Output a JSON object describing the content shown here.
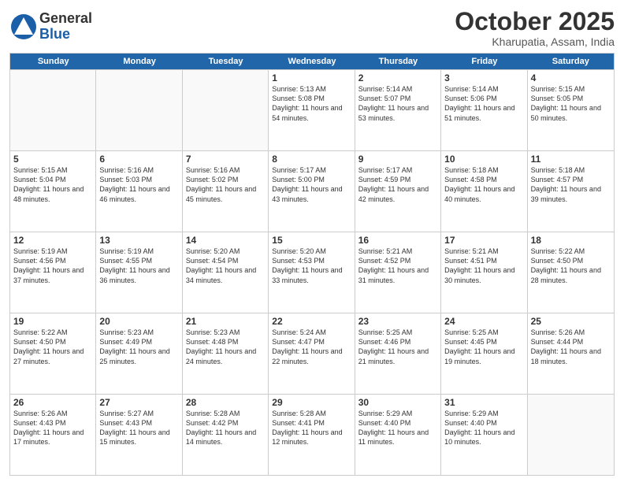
{
  "header": {
    "logo_general": "General",
    "logo_blue": "Blue",
    "month_title": "October 2025",
    "location": "Kharupatia, Assam, India"
  },
  "days_of_week": [
    "Sunday",
    "Monday",
    "Tuesday",
    "Wednesday",
    "Thursday",
    "Friday",
    "Saturday"
  ],
  "weeks": [
    [
      {
        "day": "",
        "empty": true
      },
      {
        "day": "",
        "empty": true
      },
      {
        "day": "",
        "empty": true
      },
      {
        "day": "1",
        "sunrise": "5:13 AM",
        "sunset": "5:08 PM",
        "daylight": "11 hours and 54 minutes."
      },
      {
        "day": "2",
        "sunrise": "5:14 AM",
        "sunset": "5:07 PM",
        "daylight": "11 hours and 53 minutes."
      },
      {
        "day": "3",
        "sunrise": "5:14 AM",
        "sunset": "5:06 PM",
        "daylight": "11 hours and 51 minutes."
      },
      {
        "day": "4",
        "sunrise": "5:15 AM",
        "sunset": "5:05 PM",
        "daylight": "11 hours and 50 minutes."
      }
    ],
    [
      {
        "day": "5",
        "sunrise": "5:15 AM",
        "sunset": "5:04 PM",
        "daylight": "11 hours and 48 minutes."
      },
      {
        "day": "6",
        "sunrise": "5:16 AM",
        "sunset": "5:03 PM",
        "daylight": "11 hours and 46 minutes."
      },
      {
        "day": "7",
        "sunrise": "5:16 AM",
        "sunset": "5:02 PM",
        "daylight": "11 hours and 45 minutes."
      },
      {
        "day": "8",
        "sunrise": "5:17 AM",
        "sunset": "5:00 PM",
        "daylight": "11 hours and 43 minutes."
      },
      {
        "day": "9",
        "sunrise": "5:17 AM",
        "sunset": "4:59 PM",
        "daylight": "11 hours and 42 minutes."
      },
      {
        "day": "10",
        "sunrise": "5:18 AM",
        "sunset": "4:58 PM",
        "daylight": "11 hours and 40 minutes."
      },
      {
        "day": "11",
        "sunrise": "5:18 AM",
        "sunset": "4:57 PM",
        "daylight": "11 hours and 39 minutes."
      }
    ],
    [
      {
        "day": "12",
        "sunrise": "5:19 AM",
        "sunset": "4:56 PM",
        "daylight": "11 hours and 37 minutes."
      },
      {
        "day": "13",
        "sunrise": "5:19 AM",
        "sunset": "4:55 PM",
        "daylight": "11 hours and 36 minutes."
      },
      {
        "day": "14",
        "sunrise": "5:20 AM",
        "sunset": "4:54 PM",
        "daylight": "11 hours and 34 minutes."
      },
      {
        "day": "15",
        "sunrise": "5:20 AM",
        "sunset": "4:53 PM",
        "daylight": "11 hours and 33 minutes."
      },
      {
        "day": "16",
        "sunrise": "5:21 AM",
        "sunset": "4:52 PM",
        "daylight": "11 hours and 31 minutes."
      },
      {
        "day": "17",
        "sunrise": "5:21 AM",
        "sunset": "4:51 PM",
        "daylight": "11 hours and 30 minutes."
      },
      {
        "day": "18",
        "sunrise": "5:22 AM",
        "sunset": "4:50 PM",
        "daylight": "11 hours and 28 minutes."
      }
    ],
    [
      {
        "day": "19",
        "sunrise": "5:22 AM",
        "sunset": "4:50 PM",
        "daylight": "11 hours and 27 minutes."
      },
      {
        "day": "20",
        "sunrise": "5:23 AM",
        "sunset": "4:49 PM",
        "daylight": "11 hours and 25 minutes."
      },
      {
        "day": "21",
        "sunrise": "5:23 AM",
        "sunset": "4:48 PM",
        "daylight": "11 hours and 24 minutes."
      },
      {
        "day": "22",
        "sunrise": "5:24 AM",
        "sunset": "4:47 PM",
        "daylight": "11 hours and 22 minutes."
      },
      {
        "day": "23",
        "sunrise": "5:25 AM",
        "sunset": "4:46 PM",
        "daylight": "11 hours and 21 minutes."
      },
      {
        "day": "24",
        "sunrise": "5:25 AM",
        "sunset": "4:45 PM",
        "daylight": "11 hours and 19 minutes."
      },
      {
        "day": "25",
        "sunrise": "5:26 AM",
        "sunset": "4:44 PM",
        "daylight": "11 hours and 18 minutes."
      }
    ],
    [
      {
        "day": "26",
        "sunrise": "5:26 AM",
        "sunset": "4:43 PM",
        "daylight": "11 hours and 17 minutes."
      },
      {
        "day": "27",
        "sunrise": "5:27 AM",
        "sunset": "4:43 PM",
        "daylight": "11 hours and 15 minutes."
      },
      {
        "day": "28",
        "sunrise": "5:28 AM",
        "sunset": "4:42 PM",
        "daylight": "11 hours and 14 minutes."
      },
      {
        "day": "29",
        "sunrise": "5:28 AM",
        "sunset": "4:41 PM",
        "daylight": "11 hours and 12 minutes."
      },
      {
        "day": "30",
        "sunrise": "5:29 AM",
        "sunset": "4:40 PM",
        "daylight": "11 hours and 11 minutes."
      },
      {
        "day": "31",
        "sunrise": "5:29 AM",
        "sunset": "4:40 PM",
        "daylight": "11 hours and 10 minutes."
      },
      {
        "day": "",
        "empty": true
      }
    ]
  ],
  "labels": {
    "sunrise": "Sunrise:",
    "sunset": "Sunset:",
    "daylight": "Daylight:"
  }
}
